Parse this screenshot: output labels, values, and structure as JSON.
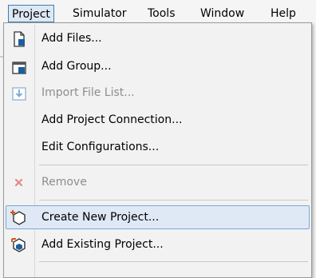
{
  "menubar": {
    "items": [
      "Project",
      "Simulator",
      "Tools",
      "Window",
      "Help"
    ]
  },
  "menu": {
    "items": [
      {
        "label": "Add Files...",
        "icon": "add-files-icon",
        "disabled": false
      },
      {
        "label": "Add Group...",
        "icon": "add-group-icon",
        "disabled": false
      },
      {
        "label": "Import File List...",
        "icon": "import-icon",
        "disabled": true
      },
      {
        "label": "Add Project Connection...",
        "icon": "",
        "disabled": false
      },
      {
        "label": "Edit Configurations...",
        "icon": "",
        "disabled": false
      },
      {
        "label": "Remove",
        "icon": "remove-icon",
        "disabled": true
      },
      {
        "label": "Create New Project...",
        "icon": "create-project-icon",
        "disabled": false,
        "highlighted": true
      },
      {
        "label": "Add Existing Project...",
        "icon": "add-existing-project-icon",
        "disabled": false
      }
    ]
  }
}
